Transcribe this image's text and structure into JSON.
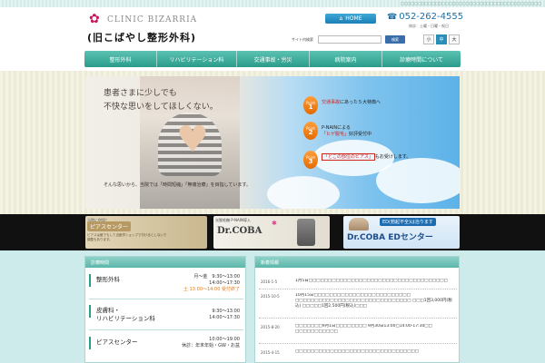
{
  "top": {
    "tagline": "□□□□□□□□□□□□□□□□□□□□□□□□□□□□□□□□□□□□□□□□□"
  },
  "logo": {
    "en": "CLINIC BIZARRIA",
    "jp": "(旧こばやし整形外科)"
  },
  "header": {
    "home_label": "HOME",
    "tel": "052-262-4555",
    "hours": "休診：土曜・日曜・祝日",
    "search_label": "サイト内検索",
    "search_placeholder": "",
    "search_button": "検索",
    "font_sizes": [
      "小",
      "中",
      "大"
    ]
  },
  "nav": [
    {
      "label": "整形外科"
    },
    {
      "label": "リハビリテーション科"
    },
    {
      "label": "交通事故・労災"
    },
    {
      "label": "病院案内"
    },
    {
      "label": "診療時間について"
    }
  ],
  "hero": {
    "catch_line1": "患者さまに少しでも",
    "catch_line2": "不快な思いをしてほしくない。",
    "sub": "そんな思いから、当院では「時間短縮」「無痛治療」を目指しています。",
    "points": [
      {
        "badge": "Point",
        "num": "1",
        "pre": "",
        "highlight": "交通事故",
        "post": "にあった５大特典へ"
      },
      {
        "badge": "Point",
        "num": "2",
        "pre": "P-NAINによる",
        "highlight": "「ヒゲ脱毛」",
        "post": "好評受付中"
      },
      {
        "badge": "Point",
        "num": "3",
        "pre": "",
        "highlight": "「どこの部位のピアス」",
        "post": "もお受けします。"
      }
    ]
  },
  "banners": {
    "pierce": {
      "t1": "当院に併設！",
      "t2": "ピアスセンター",
      "t3": "ピアスは誰でもして当医学ショップで付けるとしないで調整もあります。"
    },
    "coba": {
      "t1": "光脱毛機 P-NAIN導入",
      "t2": "Dr.COBA"
    },
    "ed": {
      "t1": "ED(勃起不全)は治ります",
      "t2": "Dr.COBA EDセンター"
    }
  },
  "hours_panel": {
    "title": "診療時間",
    "rows": [
      {
        "dept": "整形外科",
        "label": "月～金",
        "times": [
          "9:30～13:00",
          "14:00～17:30"
        ],
        "note": "土 13:00～14:00 受付終了"
      },
      {
        "dept": "皮膚科・",
        "dept2": "リハビリテーション科",
        "times": [
          "9:30～13:00",
          "14:00～17:30"
        ]
      },
      {
        "dept": "ピアスセンター",
        "times": [
          "10:00～19:00"
        ],
        "note": "休診：年末年始・GW・お盆"
      }
    ]
  },
  "news_panel": {
    "title": "新着情報",
    "items": [
      {
        "date": "2016-1-5",
        "body": "1月5日□□□□□□□□□□□□□□□□□□□□□□□□□□□□□□□□□□□□"
      },
      {
        "date": "2015-10-5",
        "body": "10月15日□□□□□□□□□□□□□□□□□□□□□□□□□ □□□□□□□□□□□□□□□□□□□□□□□□□□□□□□ □□□1回3,000円(税込) □□□□□1回2,500円(税込)□□□"
      },
      {
        "date": "2015-8-20",
        "body": "□□□□□□□9月1日□□□□□□□□ 9月30日13:00□14:00-17:30□□ □□□□□□□□□□□"
      },
      {
        "date": "2015-4-15",
        "body": "□□□□□□□□□□□□□□□□□□□□□□□□□□□□□□□□"
      }
    ]
  },
  "colors": {
    "nav": "#2a9c8b",
    "accent_blue": "#1f6ea3",
    "point_orange": "#e46a00"
  }
}
